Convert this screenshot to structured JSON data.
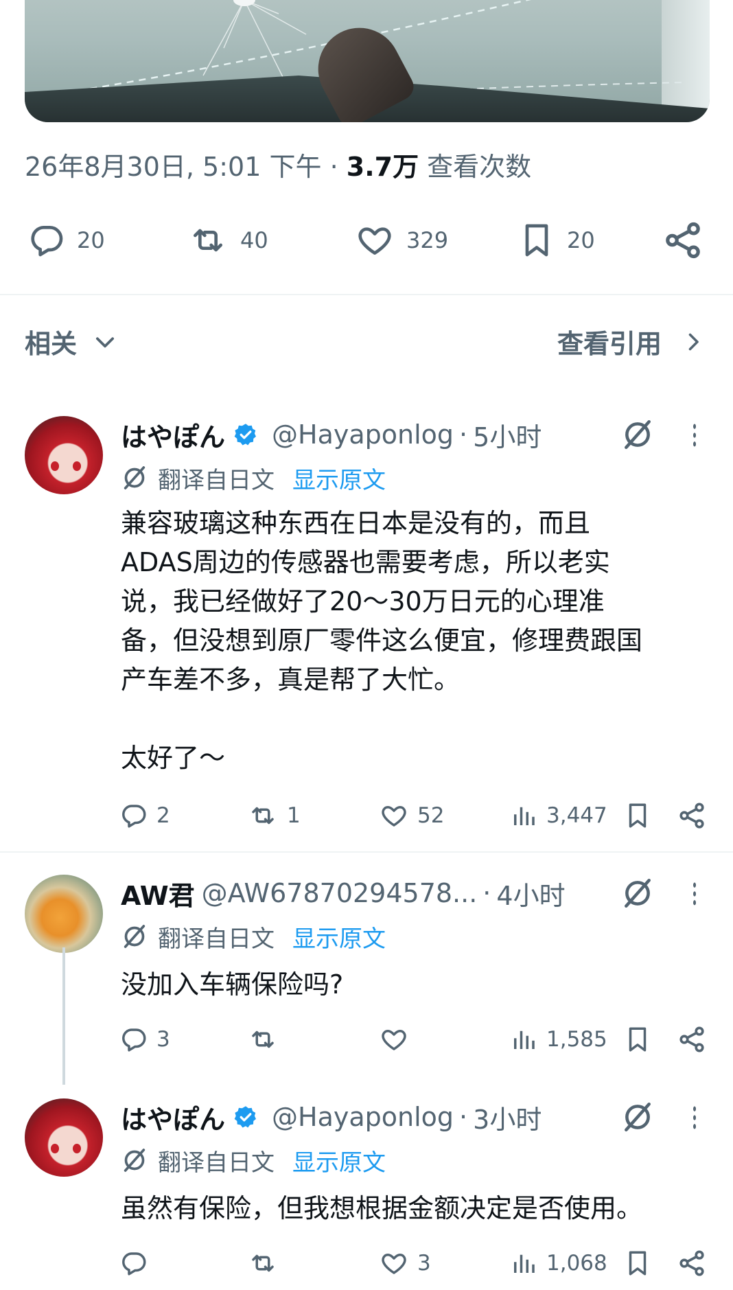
{
  "main_tweet": {
    "timestamp": "26年8月30日, 5:01 下午",
    "separator": "·",
    "views_count": "3.7万",
    "views_label": "查看次数",
    "actions": {
      "replies": "20",
      "retweets": "40",
      "likes": "329",
      "bookmarks": "20"
    }
  },
  "related_bar": {
    "related_label": "相关",
    "view_quotes_label": "查看引用"
  },
  "replies": [
    {
      "display_name": "はやぽん",
      "verified": true,
      "handle": "@Hayaponlog",
      "separator": "·",
      "time": "5小时",
      "translated_label": "翻译自日文",
      "show_original": "显示原文",
      "text_lines": [
        "兼容玻璃这种东西在日本是没有的，而且",
        "ADAS周边的传感器也需要考虑，所以老实",
        "说，我已经做好了20～30万日元的心理准",
        "备，但没想到原厂零件这么便宜，修理费跟国",
        "产车差不多，真是帮了大忙。",
        "",
        "太好了～"
      ],
      "stats": {
        "replies": "2",
        "retweets": "1",
        "likes": "52",
        "views": "3,447"
      }
    },
    {
      "display_name": "AW君",
      "verified": false,
      "handle": "@AW67870294578...",
      "separator": "·",
      "time": "4小时",
      "translated_label": "翻译自日文",
      "show_original": "显示原文",
      "text_lines": [
        "没加入车辆保险吗?"
      ],
      "stats": {
        "replies": "3",
        "retweets": "",
        "likes": "",
        "views": "1,585"
      }
    },
    {
      "display_name": "はやぽん",
      "verified": true,
      "handle": "@Hayaponlog",
      "separator": "·",
      "time": "3小时",
      "translated_label": "翻译自日文",
      "show_original": "显示原文",
      "text_lines": [
        "虽然有保险，但我想根据金额决定是否使用。"
      ],
      "stats": {
        "replies": "",
        "retweets": "",
        "likes": "3",
        "views": "1,068"
      }
    }
  ],
  "colors": {
    "text_primary": "#0f1419",
    "text_secondary": "#536471",
    "link_blue": "#1d9bf0",
    "verified_blue": "#1d9bf0",
    "divider": "#eff3f4"
  },
  "icons": {
    "reply": "speech-bubble-icon",
    "retweet": "retweet-arrows-icon",
    "like": "heart-icon",
    "bookmark": "bookmark-icon",
    "share": "share-nodes-icon",
    "views": "bar-chart-icon",
    "grok": "grok-slash-icon",
    "more": "vertical-dots-icon",
    "verified": "verified-badge-icon",
    "chevron_down": "chevron-down-icon",
    "chevron_right": "chevron-right-icon"
  }
}
